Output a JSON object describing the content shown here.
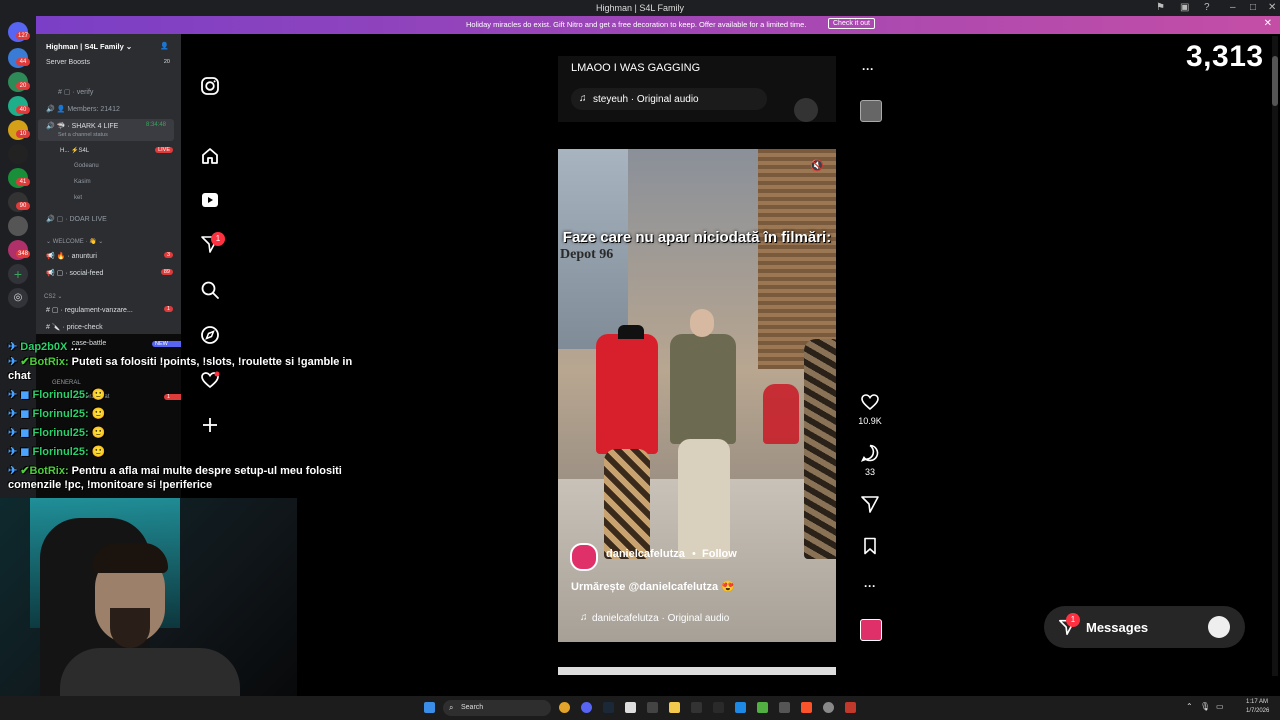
{
  "window": {
    "title": "Highman | S4L Family"
  },
  "banner": {
    "text": "Holiday miracles do exist. Gift Nitro and get a free decoration to keep. Offer available for a limited time.",
    "button": "Check it out"
  },
  "rail": {
    "badges": [
      "127",
      "44",
      "20",
      "40",
      "10",
      "41",
      "90",
      "348"
    ]
  },
  "server": {
    "name": "Highman | S4L Family",
    "boosts_label": "Server Boosts",
    "boosts_count": "20",
    "channels": {
      "verify": "verify",
      "members": "Members: 21412",
      "shark": "SHARK 4 LIFE",
      "shark_time": "8:34:48",
      "status_hint": "Set a channel status",
      "voice_users": [
        "H... ⚡S4L",
        "Godeanu",
        "Kasim",
        "ket"
      ],
      "live_badge": "LIVE",
      "doar_live": "DOAR LIVE",
      "welcome_cat": "WELCOME",
      "anunturi": "anunturi",
      "anunturi_count": "3",
      "social_feed": "social-feed",
      "social_count": "89",
      "cs2_cat": "CS2",
      "regulament": "regulament-vanzare...",
      "regulament_count": "1",
      "price_check": "price-check",
      "case_battle": "case-battle",
      "new_badge": "NEW",
      "general_cat": "GENERAL",
      "general_chat": "general-chat",
      "general_count": "1"
    }
  },
  "viewer_count": "3,313",
  "chat": [
    {
      "user": "Dap2b0X",
      "text": "…"
    },
    {
      "user": "BotRix:",
      "text": "Puteti sa folositi !points, !slots, !roulette si !gamble in"
    },
    {
      "user": "",
      "text": "chat"
    },
    {
      "user": "Florinul25:",
      "text": ""
    },
    {
      "user": "Florinul25:",
      "text": ""
    },
    {
      "user": "Florinul25:",
      "text": ""
    },
    {
      "user": "Florinul25:",
      "text": ""
    },
    {
      "user": "BotRix:",
      "text": "Pentru a afla mai multe despre setup-ul meu folositi"
    },
    {
      "user": "",
      "text": "comenzile !pc, !monitoare si !periferice"
    }
  ],
  "instagram": {
    "nav_badge": "1",
    "prev_reel": {
      "caption": "LMAOO I WAS GAGGING",
      "audio": "steyeuh · Original audio"
    },
    "reel": {
      "overlay_text": "Faze care nu apar niciodată în filmări:",
      "store_sign": "Depot 96",
      "username": "danielcafelutza",
      "follow": "Follow",
      "description": "Urmărește @danielcafelutza 😍",
      "audio": "danielcafelutza · Original audio"
    },
    "likes": "10.9K",
    "comments": "33",
    "messages_label": "Messages",
    "messages_badge": "1"
  },
  "taskbar": {
    "search": "Search",
    "time": "1:17 AM",
    "date": "1/7/2026"
  }
}
